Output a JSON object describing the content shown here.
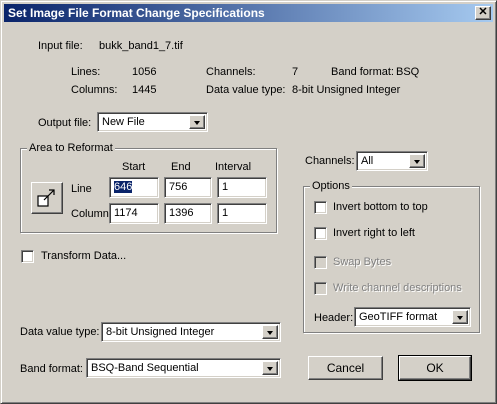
{
  "window": {
    "title": "Set Image File Format Change Specifications"
  },
  "info": {
    "input_file_label": "Input file:",
    "input_file_value": "bukk_band1_7.tif",
    "lines_label": "Lines:",
    "lines_value": "1056",
    "columns_label": "Columns:",
    "columns_value": "1445",
    "channels_label": "Channels:",
    "channels_value": "7",
    "band_format_label": "Band format:",
    "band_format_value": "BSQ",
    "data_value_type_label": "Data value type:",
    "data_value_type_value": "8-bit Unsigned Integer"
  },
  "output_file": {
    "label": "Output file:",
    "value": "New File"
  },
  "area": {
    "title": "Area to Reformat",
    "start_header": "Start",
    "end_header": "End",
    "interval_header": "Interval",
    "line_label": "Line",
    "column_label": "Column",
    "line_start": "646",
    "line_end": "756",
    "line_interval": "1",
    "column_start": "1174",
    "column_end": "1396",
    "column_interval": "1"
  },
  "channels": {
    "label": "Channels:",
    "value": "All"
  },
  "options": {
    "title": "Options",
    "invert_bottom_top": "Invert bottom to top",
    "invert_right_left": "Invert right to left",
    "swap_bytes": "Swap Bytes",
    "write_channel_descriptions": "Write channel descriptions",
    "header_label": "Header:",
    "header_value": "GeoTIFF format"
  },
  "transform": {
    "label": "Transform Data..."
  },
  "data_value_type": {
    "label": "Data value type:",
    "value": "8-bit Unsigned Integer"
  },
  "band_format": {
    "label": "Band format:",
    "value": "BSQ-Band Sequential"
  },
  "buttons": {
    "cancel": "Cancel",
    "ok": "OK"
  }
}
